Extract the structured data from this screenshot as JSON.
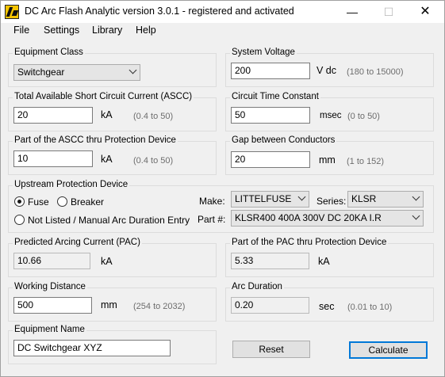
{
  "window": {
    "title": "DC Arc Flash Analytic version 3.0.1 - registered and activated",
    "minimize_glyph": "—",
    "maximize_glyph": "☐",
    "close_glyph": "✕"
  },
  "menu": {
    "items": [
      "File",
      "Settings",
      "Library",
      "Help"
    ]
  },
  "equipment_class": {
    "label": "Equipment Class",
    "value": "Switchgear"
  },
  "system_voltage": {
    "label": "System Voltage",
    "value": "200",
    "unit": "V dc",
    "range": "(180 to 15000)"
  },
  "ascc": {
    "label": "Total Available Short Circuit Current (ASCC)",
    "value": "20",
    "unit": "kA",
    "range": "(0.4 to 50)"
  },
  "time_constant": {
    "label": "Circuit Time Constant",
    "value": "50",
    "unit": "msec",
    "range": "(0 to 50)"
  },
  "ascc_thru": {
    "label": "Part of the ASCC thru Protection Device",
    "value": "10",
    "unit": "kA",
    "range": "(0.4 to 50)"
  },
  "gap": {
    "label": "Gap between Conductors",
    "value": "20",
    "unit": "mm",
    "range": "(1 to 152)"
  },
  "upstream": {
    "label": "Upstream Protection Device",
    "fuse_label": "Fuse",
    "breaker_label": "Breaker",
    "not_listed_label": "Not Listed / Manual Arc Duration Entry",
    "make_label": "Make:",
    "make_value": "LITTELFUSE",
    "series_label": "Series:",
    "series_value": "KLSR",
    "part_label": "Part #:",
    "part_value": "KLSR400 400A 300V DC 20KA I.R",
    "selected": "fuse"
  },
  "pac": {
    "label": "Predicted Arcing Current (PAC)",
    "value": "10.66",
    "unit": "kA"
  },
  "pac_thru": {
    "label": "Part of the PAC thru Protection Device",
    "value": "5.33",
    "unit": "kA"
  },
  "working_distance": {
    "label": "Working Distance",
    "value": "500",
    "unit": "mm",
    "range": "(254 to 2032)"
  },
  "arc_duration": {
    "label": "Arc Duration",
    "value": "0.20",
    "unit": "sec",
    "range": "(0.01 to 10)"
  },
  "equipment_name": {
    "label": "Equipment Name",
    "value": "DC Switchgear XYZ"
  },
  "buttons": {
    "reset": "Reset",
    "calculate": "Calculate"
  }
}
